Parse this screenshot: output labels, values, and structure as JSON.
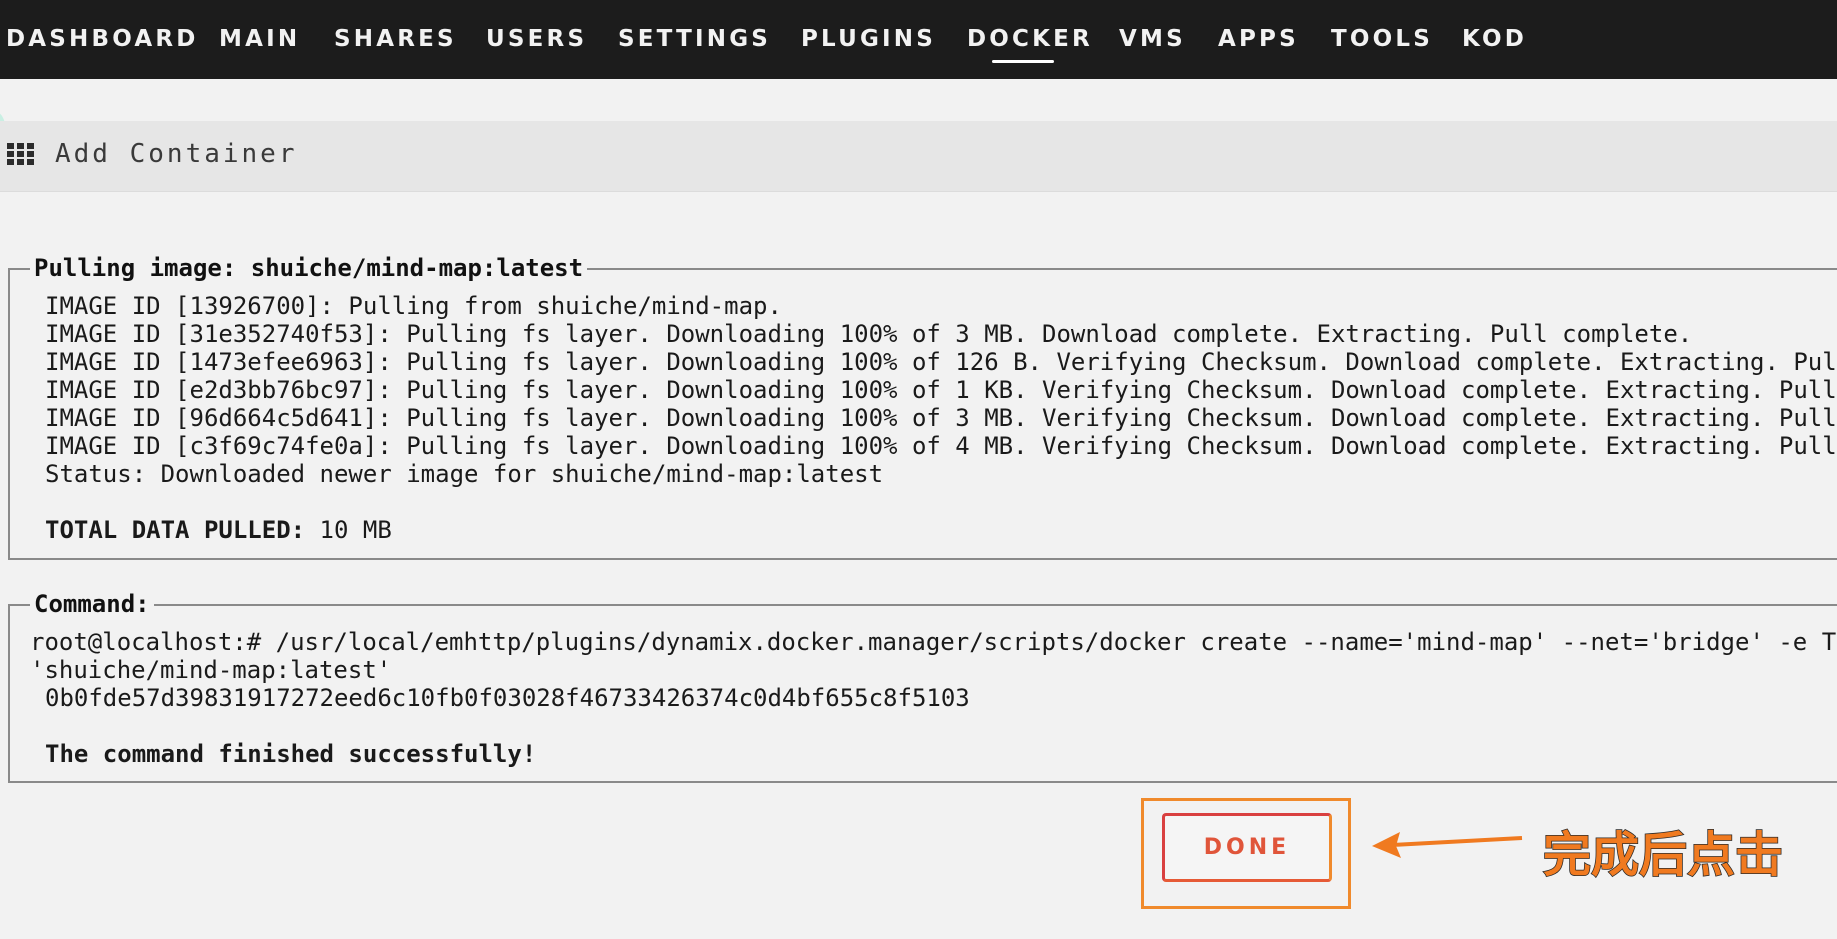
{
  "nav": {
    "items": [
      "DASHBOARD",
      "MAIN",
      "SHARES",
      "USERS",
      "SETTINGS",
      "PLUGINS",
      "DOCKER",
      "VMS",
      "APPS",
      "TOOLS",
      "KOD"
    ],
    "active": "DOCKER"
  },
  "page": {
    "title": "Add Container",
    "title_icon": "grid-icon"
  },
  "pull": {
    "legend": "Pulling image: shuiche/mind-map:latest",
    "lines": [
      "IMAGE ID [13926700]: Pulling from shuiche/mind-map.",
      "IMAGE ID [31e352740f53]: Pulling fs layer. Downloading 100% of 3 MB. Download complete. Extracting. Pull complete.",
      "IMAGE ID [1473efee6963]: Pulling fs layer. Downloading 100% of 126 B. Verifying Checksum. Download complete. Extracting. Pul",
      "IMAGE ID [e2d3bb76bc97]: Pulling fs layer. Downloading 100% of 1 KB. Verifying Checksum. Download complete. Extracting. Pull",
      "IMAGE ID [96d664c5d641]: Pulling fs layer. Downloading 100% of 3 MB. Verifying Checksum. Download complete. Extracting. Pull",
      "IMAGE ID [c3f69c74fe0a]: Pulling fs layer. Downloading 100% of 4 MB. Verifying Checksum. Download complete. Extracting. Pull",
      "Status: Downloaded newer image for shuiche/mind-map:latest"
    ],
    "total_label": "TOTAL DATA PULLED:",
    "total_value": " 10 MB"
  },
  "command": {
    "legend": "Command:",
    "line1": "root@localhost:# /usr/local/emhttp/plugins/dynamix.docker.manager/scripts/docker create --name='mind-map' --net='bridge' -e TZ",
    "line2": "'shuiche/mind-map:latest'",
    "container_id": "0b0fde57d39831917272eed6c10fb0f03028f46733426374c0d4bf655c8f5103",
    "result": "The command finished successfully!"
  },
  "done_button": {
    "label": "DONE"
  },
  "annotation": {
    "text": "完成后点击",
    "color": "#f07a20"
  },
  "colors": {
    "nav_bg": "#1c1c1c",
    "page_bg": "#f2f2f2",
    "title_bg": "#e6e6e6",
    "button_text": "#e0553a",
    "highlight": "#f08a2c"
  }
}
